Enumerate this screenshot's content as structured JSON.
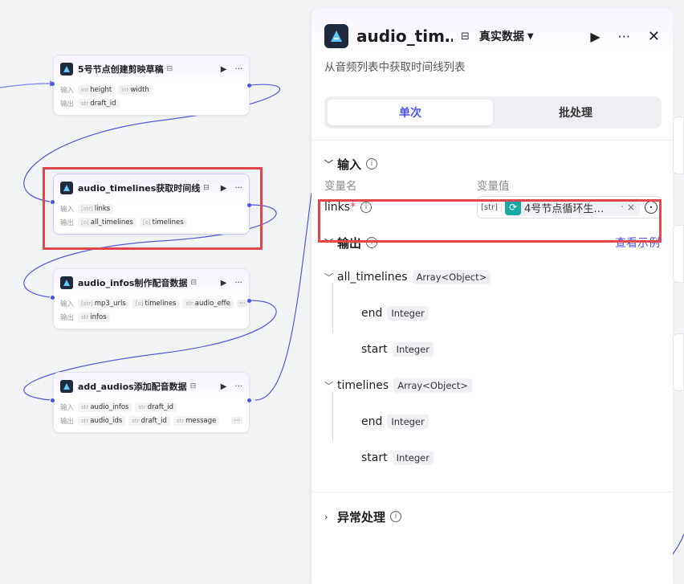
{
  "nodes": [
    {
      "title": "5号节点创建剪映草稿",
      "input_label": "输入",
      "inputs": [
        {
          "type": "int",
          "name": "height"
        },
        {
          "type": "int",
          "name": "width"
        }
      ],
      "output_label": "输出",
      "outputs": [
        {
          "type": "str",
          "name": "draft_id"
        }
      ]
    },
    {
      "title": "audio_timelines获取时间线",
      "input_label": "输入",
      "inputs": [
        {
          "type": "[str]",
          "name": "links"
        }
      ],
      "output_label": "输出",
      "outputs": [
        {
          "type": "[o]",
          "name": "all_timelines"
        },
        {
          "type": "[o]",
          "name": "timelines"
        }
      ]
    },
    {
      "title": "audio_infos制作配音数据",
      "input_label": "输入",
      "inputs": [
        {
          "type": "[str]",
          "name": "mp3_urls"
        },
        {
          "type": "[o]",
          "name": "timelines"
        },
        {
          "type": "str",
          "name": "audio_effe"
        }
      ],
      "output_label": "输出",
      "outputs": [
        {
          "type": "str",
          "name": "infos"
        }
      ]
    },
    {
      "title": "add_audios添加配音数据",
      "input_label": "输入",
      "inputs": [
        {
          "type": "str",
          "name": "audio_infos"
        },
        {
          "type": "str",
          "name": "draft_id"
        }
      ],
      "output_label": "输出",
      "outputs": [
        {
          "type": "str",
          "name": "audio_ids"
        },
        {
          "type": "str",
          "name": "draft_id"
        },
        {
          "type": "str",
          "name": "message"
        }
      ]
    }
  ],
  "node_more": "···",
  "panel": {
    "title": "audio_tim…",
    "mode": "真实数据",
    "description": "从音频列表中获取时间线列表",
    "tabs": [
      {
        "label": "单次"
      },
      {
        "label": "批处理"
      }
    ],
    "input_section": {
      "title": "输入",
      "col_name": "变量名",
      "col_value": "变量值",
      "field_name": "links",
      "required_mark": "*",
      "type_tag": "[str]",
      "value": "4号节点循环生…"
    },
    "output_section": {
      "title": "输出",
      "link": "查看示例",
      "fields": [
        {
          "name": "all_timelines",
          "type": "Array<Object>",
          "children": [
            {
              "name": "end",
              "type": "Integer"
            },
            {
              "name": "start",
              "type": "Integer"
            }
          ]
        },
        {
          "name": "timelines",
          "type": "Array<Object>",
          "children": [
            {
              "name": "end",
              "type": "Integer"
            },
            {
              "name": "start",
              "type": "Integer"
            }
          ]
        }
      ]
    },
    "error_section": {
      "title": "异常处理"
    }
  },
  "colors": {
    "accent": "#4d53e8",
    "highlight": "#e0464a",
    "loop": "#18a8a6"
  }
}
